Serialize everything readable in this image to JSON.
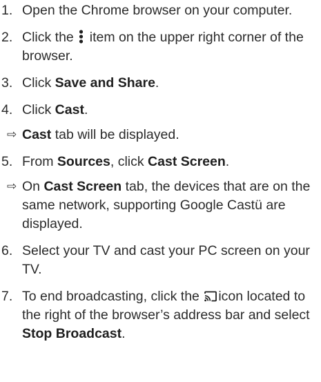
{
  "steps": [
    {
      "num": "1.",
      "text": "Open the Chrome browser on your com­puter."
    },
    {
      "num": "2.",
      "before": "Click the",
      "icon": "kebab-menu-icon",
      "after": "item on the upper right corner of the browser."
    },
    {
      "num": "3.",
      "before": "Click ",
      "bold": "Save and Share",
      "after": "."
    },
    {
      "num": "4.",
      "before": "Click ",
      "bold": "Cast",
      "after": "."
    },
    {
      "num": "5.",
      "before": "From ",
      "bold1": "Sources",
      "middle": ", click ",
      "bold2": "Cast Screen",
      "after": "."
    },
    {
      "num": "6.",
      "text": "Select your TV and cast your PC screen on your TV."
    },
    {
      "num": "7.",
      "before": "To end broadcasting, click the",
      "icon": "cast-icon",
      "middle": "icon located to the right of the browser’s ad­dress bar and select ",
      "bold": "Stop Broadcast",
      "after": "."
    }
  ],
  "results": {
    "after_step4": {
      "arrow": "⇨",
      "bold": "Cast",
      "text": " tab will be displayed."
    },
    "after_step5": {
      "arrow": "⇨",
      "before": "On ",
      "bold": "Cast Screen",
      "text": " tab, the devices that are on the same network, supporting Google Castü are displayed."
    }
  }
}
